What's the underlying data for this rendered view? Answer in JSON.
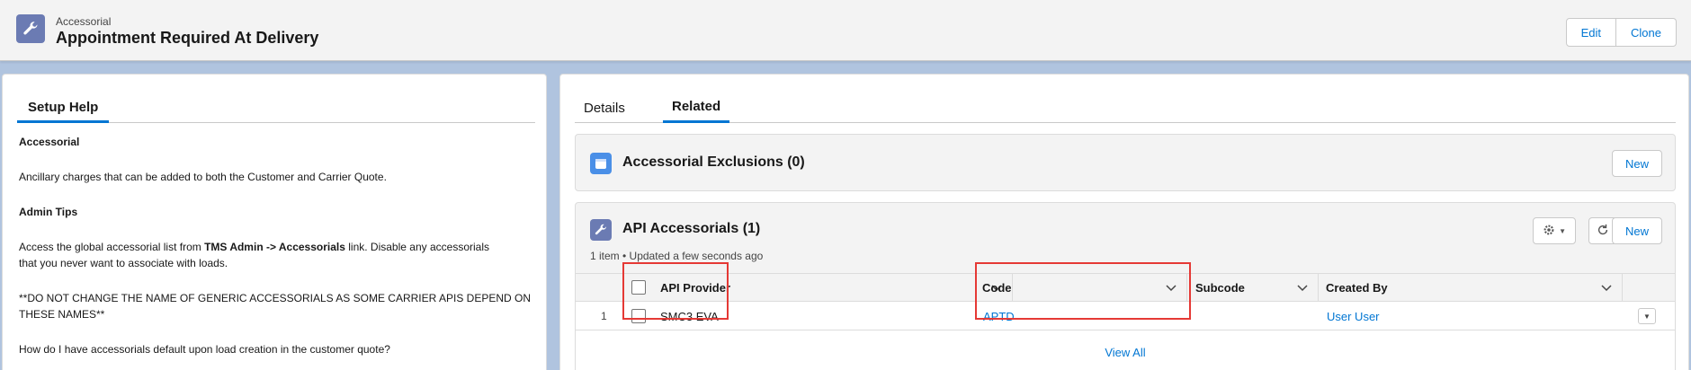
{
  "header": {
    "object_label": "Accessorial",
    "title": "Appointment Required At Delivery",
    "edit_label": "Edit",
    "clone_label": "Clone",
    "icon": "wrench-icon"
  },
  "setup_help": {
    "tab_label": "Setup Help",
    "heading1": "Accessorial",
    "para1": "Ancillary charges that can be added to both the Customer and Carrier Quote.",
    "heading2": "Admin Tips",
    "para2_pre": "Access the global accessorial list from ",
    "para2_b1": "TMS Admin -> Accessorials",
    "para2_post": " link. Disable any accessorials",
    "para2_line2": "that you never want to associate with loads.",
    "warn_line1": "**DO NOT CHANGE THE NAME OF GENERIC ACCESSORIALS AS SOME CARRIER APIS DEPEND ON",
    "warn_line2": "THESE NAMES**",
    "question": "How do I have accessorials default upon load creation in the customer quote?"
  },
  "tabs": [
    {
      "label": "Details"
    },
    {
      "label": "Related"
    }
  ],
  "exclusions_card": {
    "title": "Accessorial Exclusions (0)",
    "new_label": "New",
    "icon": "calendar-icon",
    "color": "#4a8fe7"
  },
  "api_card": {
    "title": "API Accessorials (1)",
    "meta": "1 item • Updated a few seconds ago",
    "new_label": "New",
    "icon": "wrench-icon",
    "columns": [
      "API Provider",
      "Code",
      "Subcode",
      "Created By"
    ],
    "rows": [
      {
        "num": "1",
        "provider": "SMC3 EVA",
        "code": "APTD",
        "subcode": "",
        "created_by": "User User"
      }
    ],
    "view_all": "View All"
  }
}
